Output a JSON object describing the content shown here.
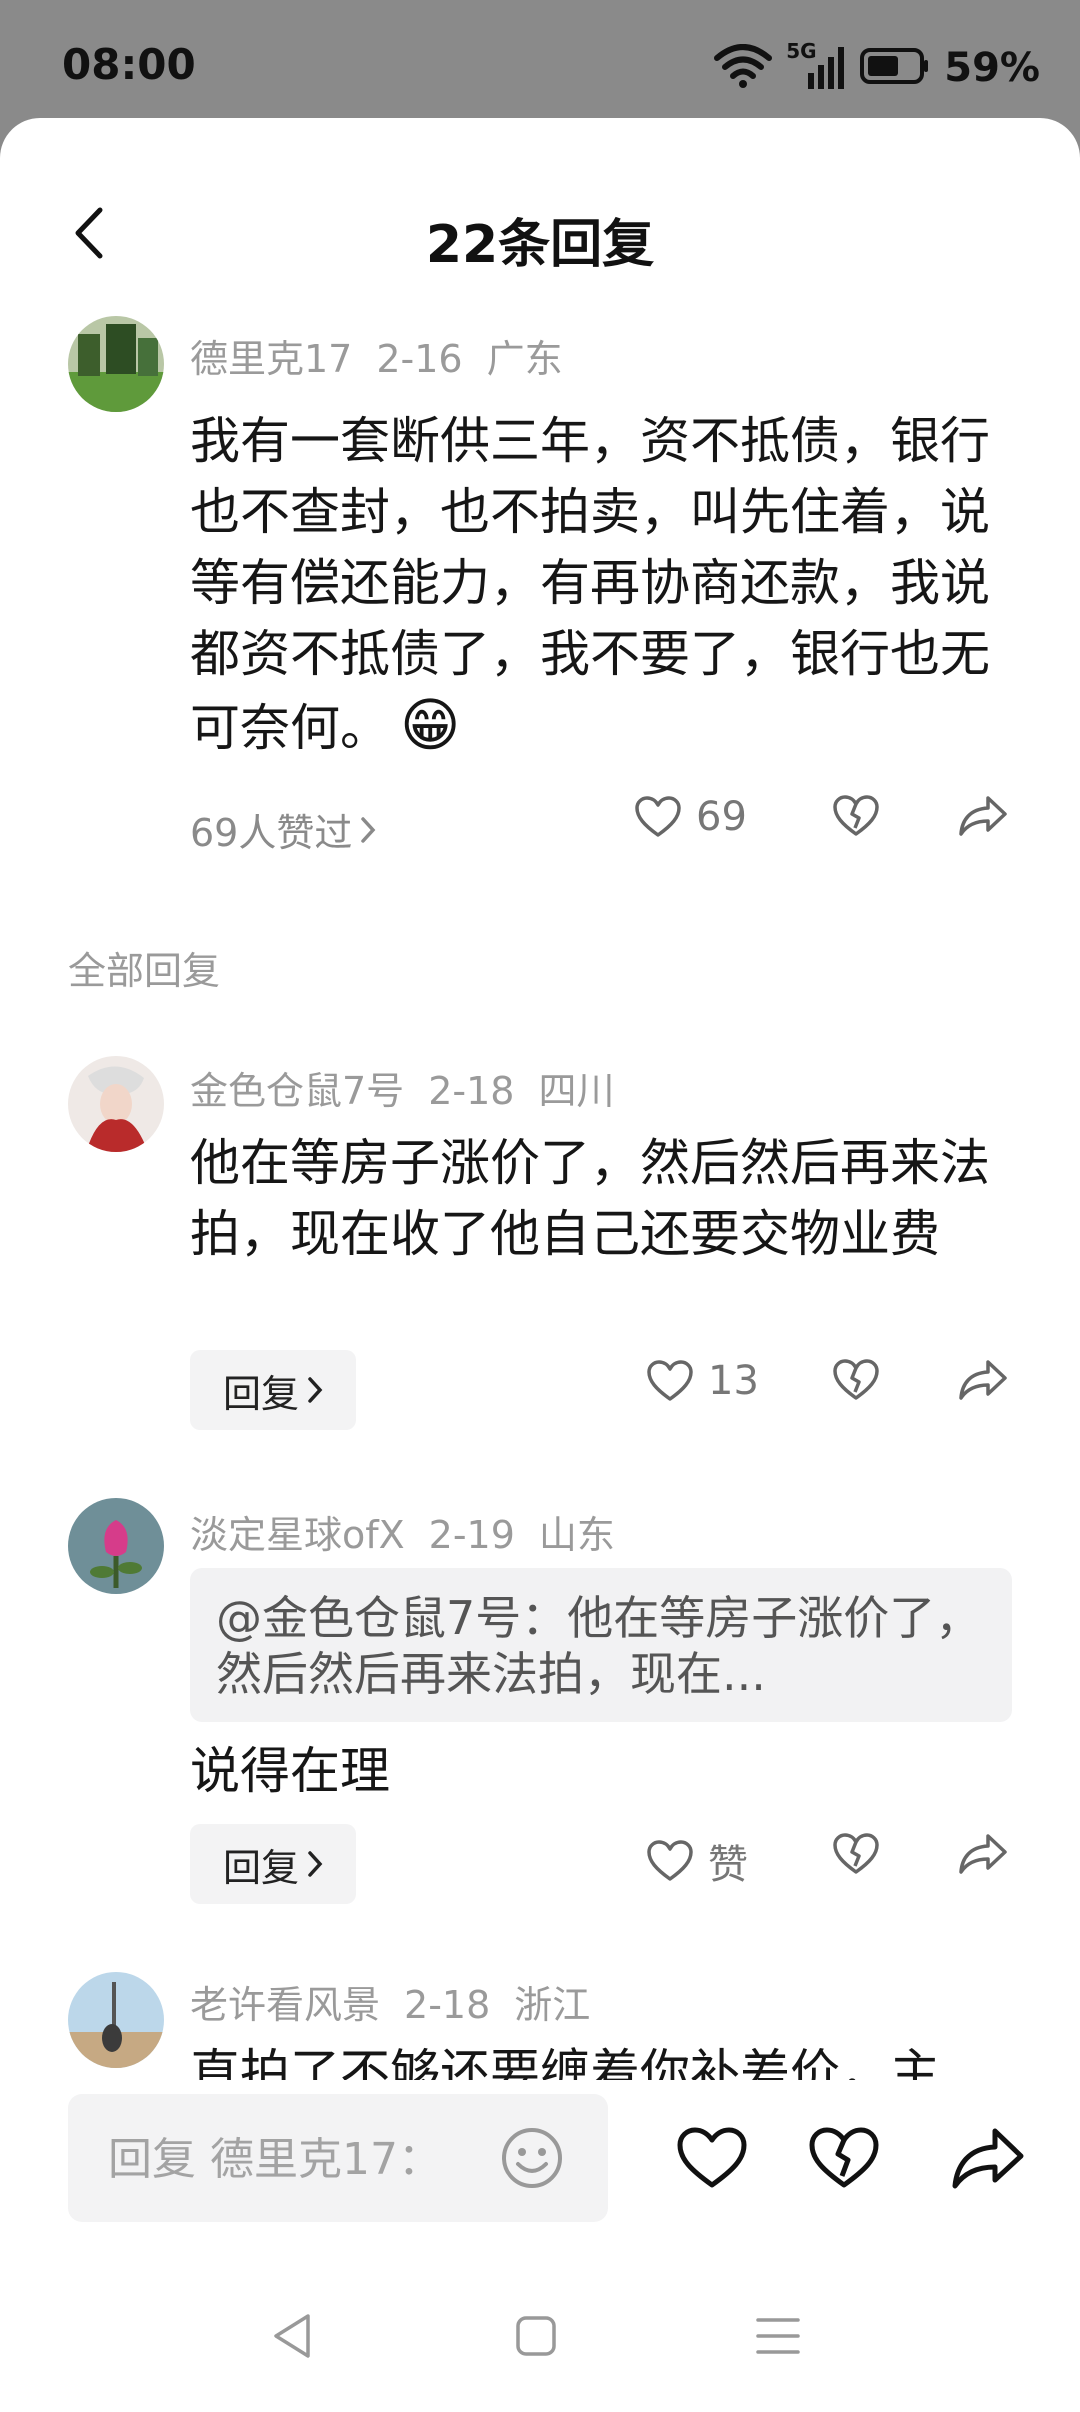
{
  "status_bar": {
    "time": "08:00",
    "network": "5G",
    "battery": "59%"
  },
  "header": {
    "title": "22条回复"
  },
  "main_comment": {
    "author": "德里克17",
    "date": "2-16",
    "location": "广东",
    "text": "我有一套断供三年，资不抵债，银行也不查封，也不拍卖，叫先住着，说等有偿还能力，有再协商还款，我说都资不抵债了，我不要了，银行也无可奈何。",
    "emoji": "😁",
    "likes_link": "69人赞过",
    "like_count": "69"
  },
  "section_label": "全部回复",
  "replies": [
    {
      "author": "金色仓鼠7号",
      "date": "2-18",
      "location": "四川",
      "text": "他在等房子涨价了，然后然后再来法拍，现在收了他自己还要交物业费",
      "reply_label": "回复",
      "like_count": "13"
    },
    {
      "author": "淡定星球ofX",
      "date": "2-19",
      "location": "山东",
      "quote": "@金色仓鼠7号：他在等房子涨价了，然后然后再来法拍，现在...",
      "text": "说得在理",
      "reply_label": "回复",
      "like_count": "赞"
    },
    {
      "author": "老许看风景",
      "date": "2-18",
      "location": "浙江",
      "text": "直拍了不够还要缠着你补差价，主"
    }
  ],
  "bottom_bar": {
    "input_placeholder": "回复 德里克17："
  },
  "colors": {
    "accent_text": "#161616",
    "meta": "#9a9a9a",
    "sheet_bg": "#ffffff",
    "backdrop": "#8a8a8a"
  }
}
